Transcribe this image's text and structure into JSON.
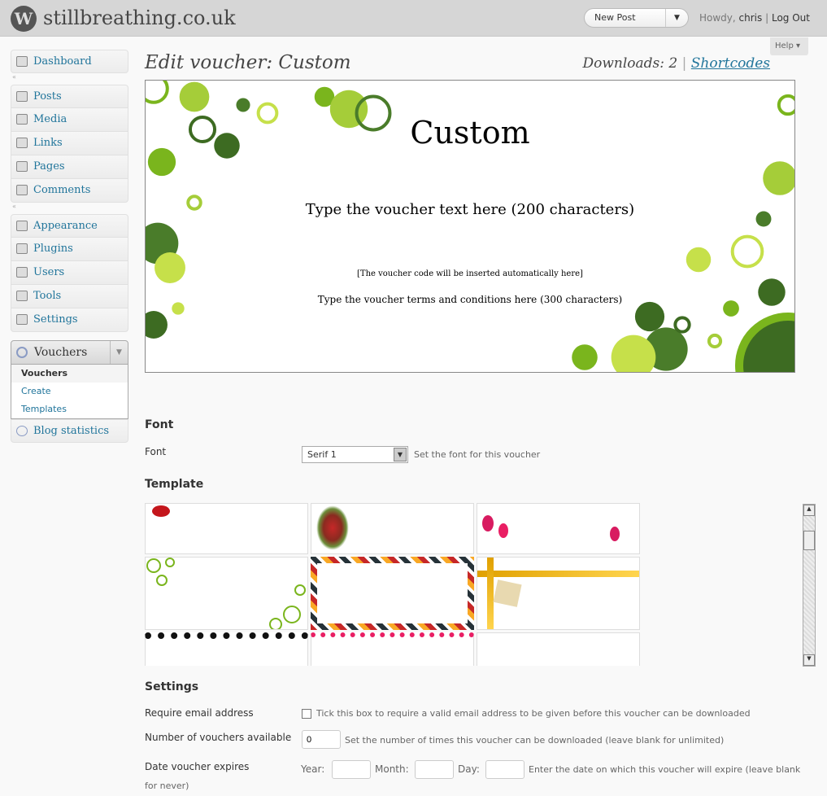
{
  "header": {
    "site_title": "stillbreathing.co.uk",
    "new_post": "New Post",
    "howdy": "Howdy,",
    "user": "chris",
    "separator": "|",
    "logout": "Log Out",
    "help": "Help"
  },
  "sidebar": {
    "group1": [
      {
        "label": "Dashboard"
      }
    ],
    "group2": [
      {
        "label": "Posts"
      },
      {
        "label": "Media"
      },
      {
        "label": "Links"
      },
      {
        "label": "Pages"
      },
      {
        "label": "Comments"
      }
    ],
    "group3": [
      {
        "label": "Appearance"
      },
      {
        "label": "Plugins"
      },
      {
        "label": "Users"
      },
      {
        "label": "Tools"
      },
      {
        "label": "Settings"
      }
    ],
    "vouchers": {
      "label": "Vouchers",
      "items": [
        {
          "label": "Vouchers"
        },
        {
          "label": "Create"
        },
        {
          "label": "Templates"
        }
      ]
    },
    "blog_stats": "Blog statistics"
  },
  "page": {
    "title": "Edit voucher: Custom",
    "downloads": "Downloads: 2",
    "separator": "|",
    "shortcodes": "Shortcodes"
  },
  "preview": {
    "name": "Custom",
    "text": "Type the voucher text here (200 characters)",
    "code": "[The voucher code will be inserted automatically here]",
    "terms": "Type the voucher terms and conditions here (300 characters)",
    "accent": "#7ab51d"
  },
  "font": {
    "heading": "Font",
    "label": "Font",
    "value": "Serif 1",
    "note": "Set the font for this voucher"
  },
  "template": {
    "heading": "Template"
  },
  "settings": {
    "heading": "Settings",
    "email": {
      "label": "Require email address",
      "checked": false,
      "note": "Tick this box to require a valid email address to be given before this voucher can be downloaded"
    },
    "count": {
      "label": "Number of vouchers available",
      "value": "0",
      "note": "Set the number of times this voucher can be downloaded (leave blank for unlimited)"
    },
    "expiry": {
      "label": "Date voucher expires",
      "year": "Year:",
      "month": "Month:",
      "day": "Day:",
      "note": "Enter the date on which this voucher will expire (leave blank",
      "note2": "for never)"
    }
  }
}
